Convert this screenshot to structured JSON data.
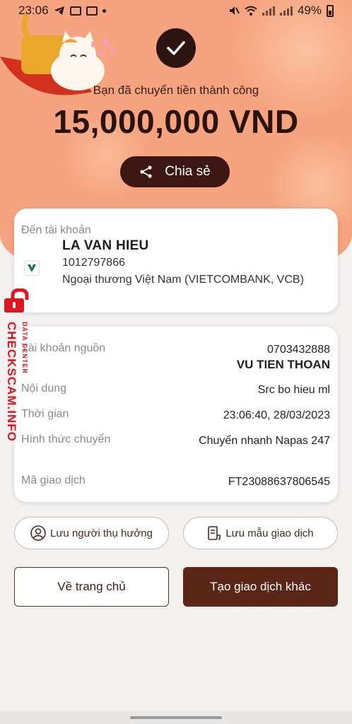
{
  "status_bar": {
    "time": "23:06",
    "battery": "49%"
  },
  "header": {
    "success_message": "Bạn đã chuyển tiền thành công",
    "amount": "15,000,000 VND",
    "share_label": "Chia sẻ"
  },
  "recipient": {
    "label": "Đến tài khoản",
    "name": "LA VAN HIEU",
    "account": "1012797866",
    "bank": "Ngoại thương Việt Nam (VIETCOMBANK, VCB)"
  },
  "details": {
    "source_label": "Tài khoản nguồn",
    "source_account": "0703432888",
    "source_name": "VU TIEN THOAN",
    "content_label": "Nội dung",
    "content_value": "Src bo hieu ml",
    "time_label": "Thời gian",
    "time_value": "23:06:40, 28/03/2023",
    "method_label": "Hình thức chuyển",
    "method_value": "Chuyển nhanh Napas 247",
    "txn_label": "Mã giao dịch",
    "txn_value": "FT23088637806545"
  },
  "actions": {
    "save_beneficiary": "Lưu người thụ hưởng",
    "save_template": "Lưu mẫu giao dịch",
    "home": "Về trang chủ",
    "new_transaction": "Tạo giao dịch khác"
  },
  "watermark": {
    "text": "CHECKSCAM.INFO",
    "sub": "DATA CENTER"
  },
  "colors": {
    "hero_bg": "#f6a47f",
    "brand_dark": "#3b1612",
    "primary_button": "#5a2616",
    "watermark_red": "#e0141b"
  }
}
